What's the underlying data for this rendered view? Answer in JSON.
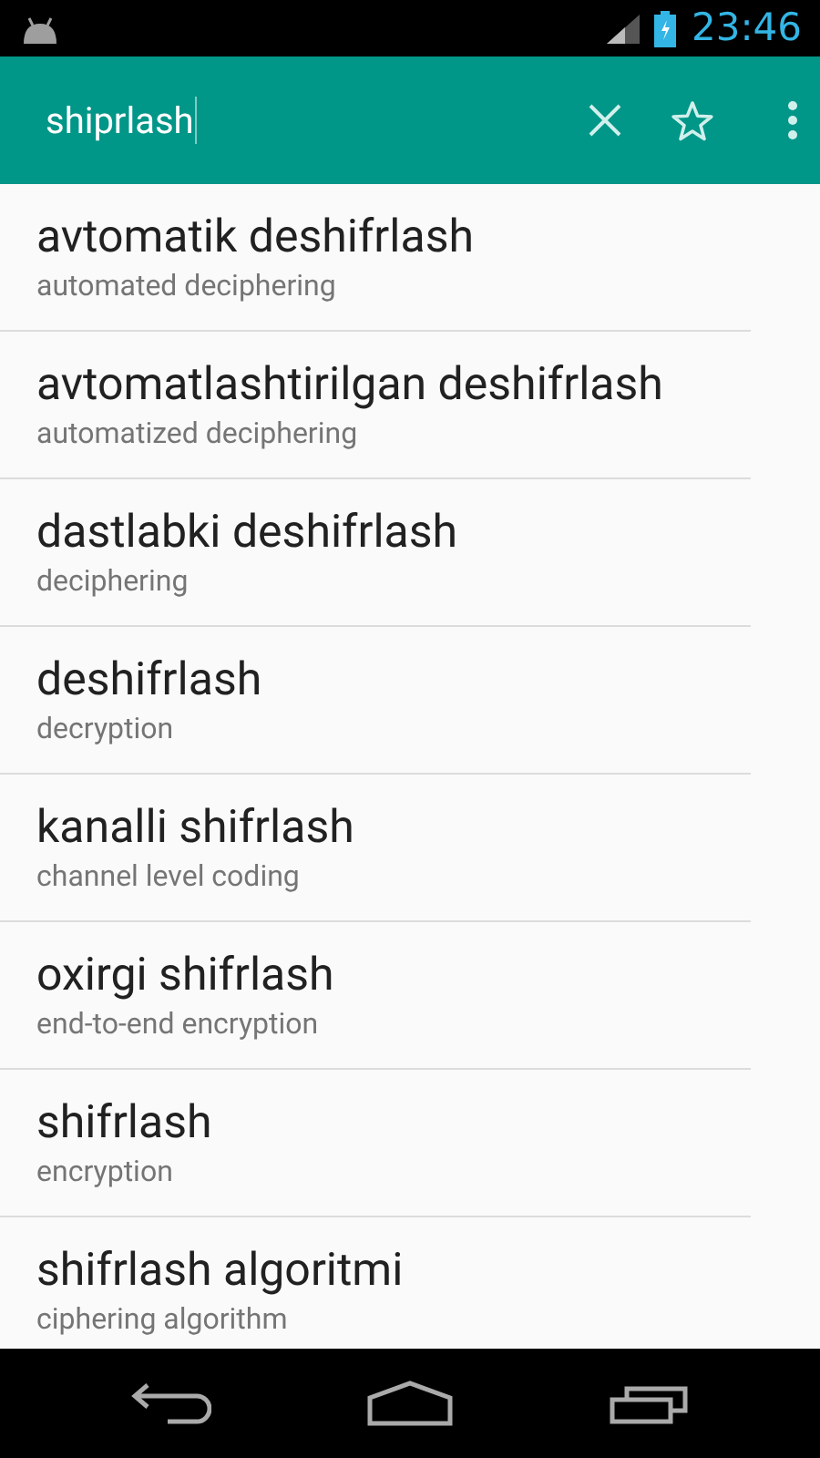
{
  "status_bar": {
    "time": "23:46"
  },
  "search": {
    "value": "shiprlash"
  },
  "results": [
    {
      "term": "avtomatik deshifrlash",
      "translation": "automated deciphering"
    },
    {
      "term": "avtomatlashtirilgan deshifrlash",
      "translation": "automatized deciphering"
    },
    {
      "term": "dastlabki deshifrlash",
      "translation": "deciphering"
    },
    {
      "term": "deshifrlash",
      "translation": "decryption"
    },
    {
      "term": "kanalli shifrlash",
      "translation": "channel level coding"
    },
    {
      "term": "oxirgi shifrlash",
      "translation": "end-to-end encryption"
    },
    {
      "term": "shifrlash",
      "translation": "encryption"
    },
    {
      "term": "shifrlash algoritmi",
      "translation": "ciphering algorithm"
    }
  ]
}
